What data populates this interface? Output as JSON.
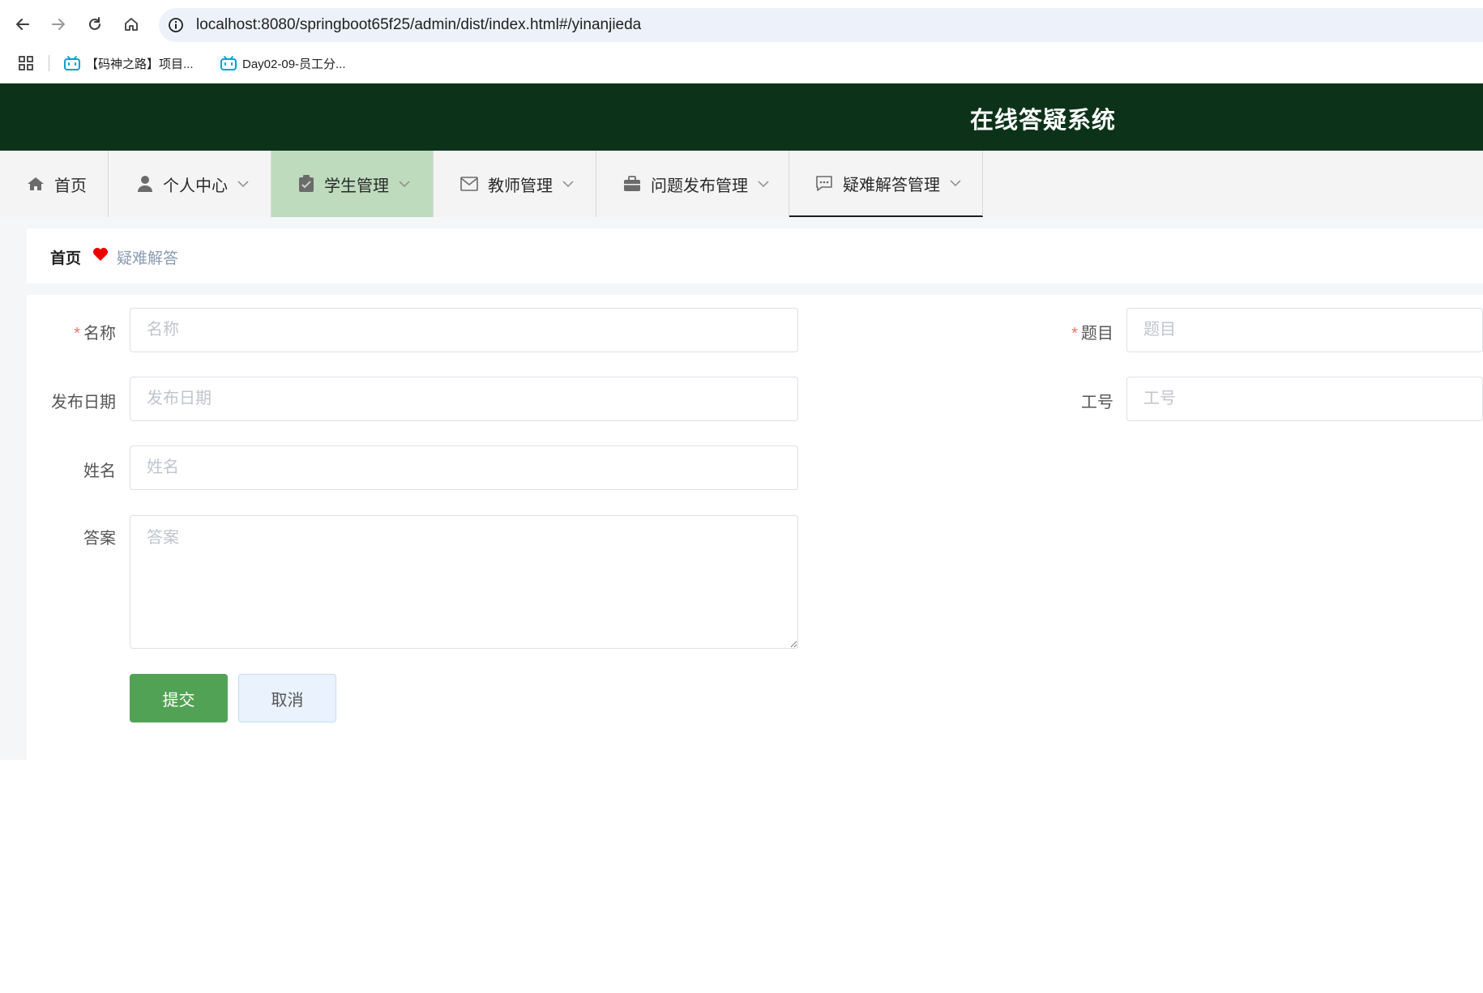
{
  "browser": {
    "url": "localhost:8080/springboot65f25/admin/dist/index.html#/yinanjieda",
    "bookmarks": [
      {
        "label": "【码神之路】项目..."
      },
      {
        "label": "Day02-09-员工分..."
      }
    ]
  },
  "app": {
    "title": "在线答疑系统",
    "header_color": "#0c3319",
    "accent_green": "#52a255"
  },
  "menu": {
    "items": [
      {
        "label": "首页",
        "icon": "home-icon"
      },
      {
        "label": "个人中心",
        "icon": "user-icon"
      },
      {
        "label": "学生管理",
        "icon": "clipboard-icon"
      },
      {
        "label": "教师管理",
        "icon": "mail-icon"
      },
      {
        "label": "问题发布管理",
        "icon": "briefcase-icon"
      },
      {
        "label": "疑难解答管理",
        "icon": "chat-icon"
      }
    ]
  },
  "breadcrumb": {
    "home": "首页",
    "current": "疑难解答"
  },
  "form": {
    "name": {
      "label": "名称",
      "placeholder": "名称",
      "required": true
    },
    "topic": {
      "label": "题目",
      "placeholder": "题目",
      "required": true
    },
    "publish_date": {
      "label": "发布日期",
      "placeholder": "发布日期"
    },
    "staff_no": {
      "label": "工号",
      "placeholder": "工号"
    },
    "person_name": {
      "label": "姓名",
      "placeholder": "姓名"
    },
    "answer": {
      "label": "答案",
      "placeholder": "答案"
    },
    "required_mark": "*",
    "submit_label": "提交",
    "cancel_label": "取消"
  }
}
